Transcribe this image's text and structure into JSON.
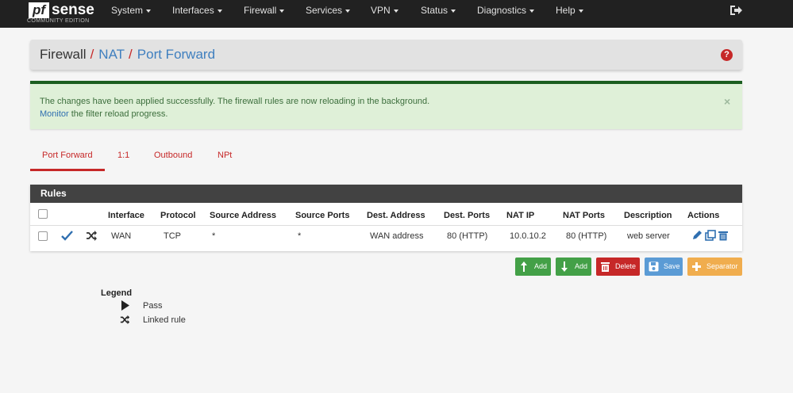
{
  "navbar": {
    "logo": {
      "pf": "pf",
      "sense": "sense",
      "edition": "COMMUNITY EDITION"
    },
    "menu": [
      "System",
      "Interfaces",
      "Firewall",
      "Services",
      "VPN",
      "Status",
      "Diagnostics",
      "Help"
    ],
    "logout_icon": "sign-out-icon"
  },
  "breadcrumb": {
    "items": [
      "Firewall",
      "NAT",
      "Port Forward"
    ],
    "separator": "/"
  },
  "help_icon": "?",
  "alert": {
    "line1": "The changes have been applied successfully. The firewall rules are now reloading in the background.",
    "line2_link": "Monitor",
    "line2_rest": " the filter reload progress.",
    "close": "×"
  },
  "tabs": [
    "Port Forward",
    "1:1",
    "Outbound",
    "NPt"
  ],
  "active_tab": "Port Forward",
  "rules": {
    "title": "Rules",
    "columns": [
      "Interface",
      "Protocol",
      "Source Address",
      "Source Ports",
      "Dest. Address",
      "Dest. Ports",
      "NAT IP",
      "NAT Ports",
      "Description",
      "Actions"
    ],
    "rows": [
      {
        "interface": "WAN",
        "protocol": "TCP",
        "source_address": "*",
        "source_ports": "*",
        "dest_address": "WAN address",
        "dest_ports": "80 (HTTP)",
        "nat_ip": "10.0.10.2",
        "nat_ports": "80 (HTTP)",
        "description": "web server",
        "status_icon": "check-icon",
        "linked_icon": "shuffle-icon"
      }
    ]
  },
  "buttons": {
    "add_top": "Add",
    "add_bottom": "Add",
    "delete": "Delete",
    "save": "Save",
    "separator": "Separator"
  },
  "legend": {
    "title": "Legend",
    "pass": "Pass",
    "linked": "Linked rule"
  },
  "colors": {
    "navbar": "#212121",
    "accent_red": "#c62828",
    "link_blue": "#3f7fbf",
    "success_green": "#43a047",
    "alert_bg": "#dff0d8",
    "save_blue": "#5b9bd5",
    "separator_orange": "#f0ad4e"
  }
}
